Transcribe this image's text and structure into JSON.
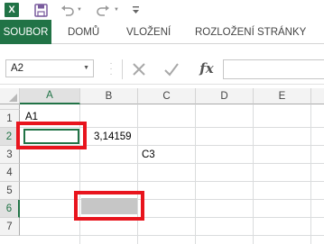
{
  "app": {
    "logo_letter": "X"
  },
  "quick_access": {
    "icons": [
      "excel-logo-icon",
      "save-icon",
      "undo-icon",
      "redo-icon",
      "customize-caret-icon"
    ]
  },
  "ribbon": {
    "tabs": [
      {
        "label": "SOUBOR",
        "active": true
      },
      {
        "label": "DOMŮ"
      },
      {
        "label": "VLOŽENÍ"
      },
      {
        "label": "ROZLOŽENÍ STRÁNKY"
      }
    ]
  },
  "formula_bar": {
    "name_box": "A2",
    "formula": "",
    "fx_label": "fx"
  },
  "grid": {
    "columns": [
      "A",
      "B",
      "C",
      "D",
      "E"
    ],
    "rows": [
      "1",
      "2",
      "3",
      "4",
      "5",
      "6",
      "7"
    ],
    "selected_column": "A",
    "selected_rows": [
      "2",
      "6"
    ],
    "cells": {
      "A1": "A1",
      "B2": "3,14159",
      "C3": "C3"
    }
  },
  "colors": {
    "accent": "#217346",
    "highlight": "#e8141d"
  }
}
